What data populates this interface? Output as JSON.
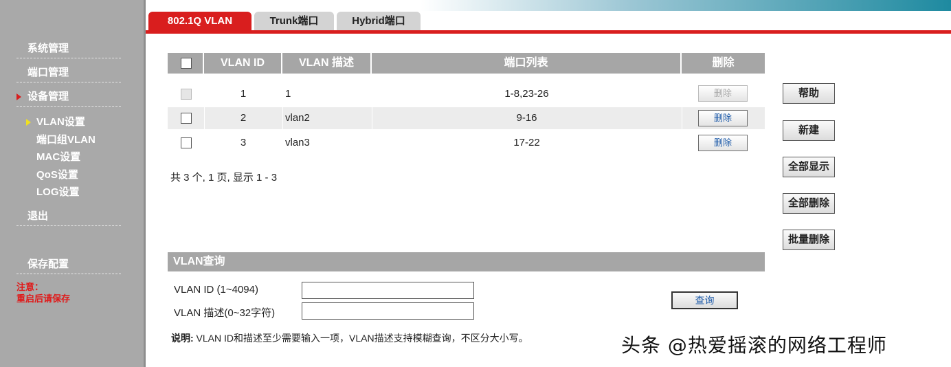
{
  "sidebar": {
    "items": [
      {
        "label": "系统管理"
      },
      {
        "label": "端口管理"
      },
      {
        "label": "设备管理"
      },
      {
        "label": "退出"
      },
      {
        "label": "保存配置"
      }
    ],
    "subitems": [
      {
        "label": "VLAN设置"
      },
      {
        "label": "端口组VLAN"
      },
      {
        "label": "MAC设置"
      },
      {
        "label": "QoS设置"
      },
      {
        "label": "LOG设置"
      }
    ],
    "note_line1": "注意：",
    "note_line2": "重启后请保存"
  },
  "tabs": [
    {
      "label": "802.1Q VLAN"
    },
    {
      "label": "Trunk端口"
    },
    {
      "label": "Hybrid端口"
    }
  ],
  "table": {
    "headers": [
      "VLAN ID",
      "VLAN 描述",
      "端口列表",
      "删除"
    ],
    "rows": [
      {
        "id": "1",
        "desc": "1",
        "ports": "1-8,23-26",
        "delete": "删除",
        "deletable": false
      },
      {
        "id": "2",
        "desc": "vlan2",
        "ports": "9-16",
        "delete": "删除",
        "deletable": true
      },
      {
        "id": "3",
        "desc": "vlan3",
        "ports": "17-22",
        "delete": "删除",
        "deletable": true
      }
    ],
    "summary": "共 3 个, 1 页, 显示 1 - 3"
  },
  "side_buttons": [
    "帮助",
    "新建",
    "全部显示",
    "全部删除",
    "批量删除"
  ],
  "query": {
    "title": "VLAN查询",
    "id_label": "VLAN ID (1~4094)",
    "desc_label": "VLAN 描述(0~32字符)",
    "id_value": "",
    "desc_value": "",
    "button": "查询",
    "note_bold": "说明:",
    "note_text": " VLAN ID和描述至少需要输入一项，VLAN描述支持模糊查询，不区分大小写。"
  },
  "watermark": "头条 @热爱摇滚的网络工程师",
  "colors": {
    "accent": "#d91e1e",
    "sidebar": "#a9a9a9",
    "header_gray": "#a6a6a6"
  }
}
